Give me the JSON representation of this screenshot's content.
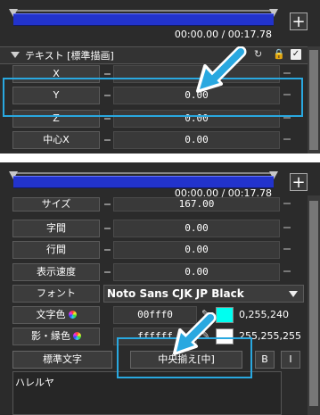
{
  "top_panel": {
    "time": "00:00.00 / 00:17.78",
    "add_label": "+",
    "section_title": "テキスト [標準描画]",
    "rows": [
      {
        "label": "X",
        "value": ""
      },
      {
        "label": "Y",
        "value": "0.00"
      },
      {
        "label": "Z",
        "value": "0.00"
      },
      {
        "label": "中心X",
        "value": "0.00"
      }
    ]
  },
  "bottom_panel": {
    "time": "00:00.00 / 00:17.78",
    "add_label": "+",
    "rows": [
      {
        "label": "サイズ",
        "value": "167.00"
      },
      {
        "label": "字間",
        "value": "0.00"
      },
      {
        "label": "行間",
        "value": "0.00"
      },
      {
        "label": "表示速度",
        "value": "0.00"
      }
    ],
    "font": {
      "label": "フォント",
      "value": "Noto Sans CJK JP Black"
    },
    "text_color": {
      "label": "文字色",
      "hex": "00fff0",
      "rgb": "0,255,240",
      "swatch": "#00fff0"
    },
    "shadow_color": {
      "label": "影・縁色",
      "hex": "ffffff",
      "rgb": "255,255,255",
      "swatch": "#ffffff"
    },
    "buttons": {
      "standard": "標準文字",
      "align": "中央揃え[中]",
      "bold": "B",
      "italic": "I"
    },
    "text_content": "ハレルヤ"
  },
  "colors": {
    "highlight": "#29a8e0",
    "timeline": "#2233cc"
  }
}
